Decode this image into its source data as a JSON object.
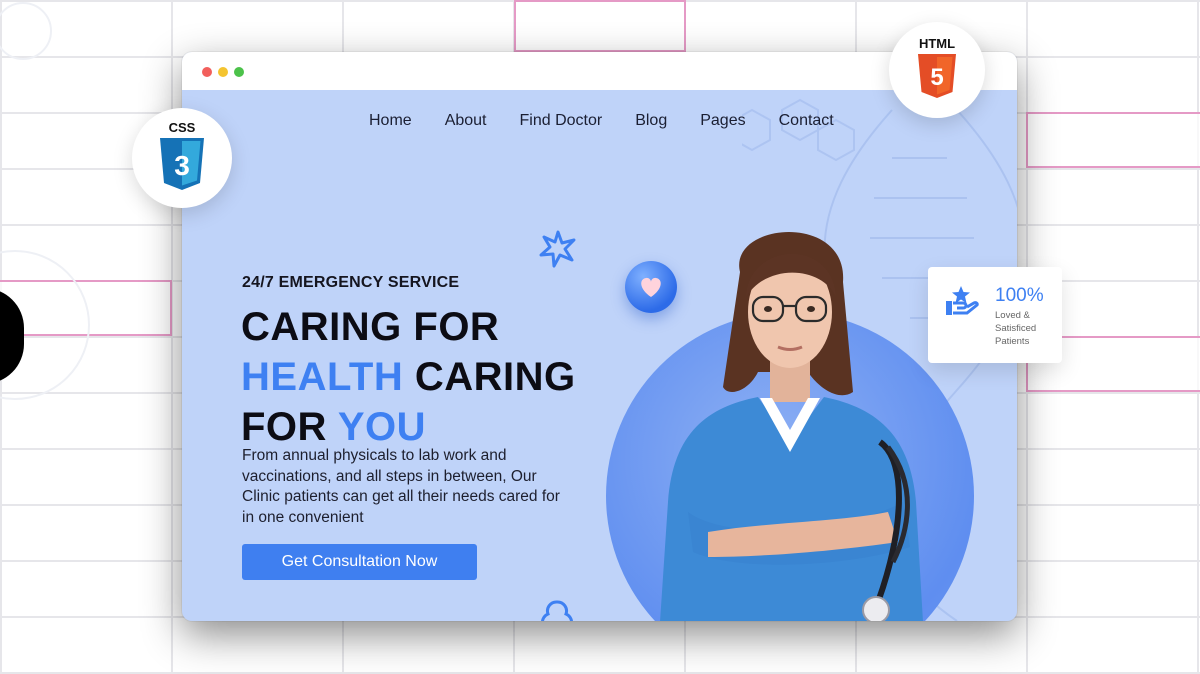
{
  "nav": {
    "items": [
      {
        "label": "Home"
      },
      {
        "label": "About"
      },
      {
        "label": "Find Doctor"
      },
      {
        "label": "Blog"
      },
      {
        "label": "Pages"
      },
      {
        "label": "Contact"
      }
    ]
  },
  "hero": {
    "eyebrow": "24/7 EMERGENCY SERVICE",
    "headline_line1": "CARING FOR",
    "headline_line2_accent": "HEALTH",
    "headline_line2_rest": "CARING",
    "headline_line3_prefix": "FOR",
    "headline_line3_accent": "YOU",
    "description": "From annual physicals to lab work and vaccinations, and all steps in between, Our Clinic patients can get all their needs cared for in one convenient",
    "cta_label": "Get Consultation Now"
  },
  "badges": {
    "css_label": "CSS",
    "css_number": "3",
    "html_label": "HTML",
    "html_number": "5"
  },
  "stat": {
    "value": "100%",
    "label": "Loved & Satisficed Patients"
  },
  "colors": {
    "accent": "#3e80f2",
    "page_bg": "#bfd3f9",
    "css_blue": "#2965f1",
    "html_orange": "#e44d26",
    "pink_outline": "#e59ac6"
  },
  "icons": [
    "heart-icon",
    "flower-icon",
    "dna-icon",
    "hand-star-icon",
    "css3-shield-icon",
    "html5-shield-icon"
  ]
}
